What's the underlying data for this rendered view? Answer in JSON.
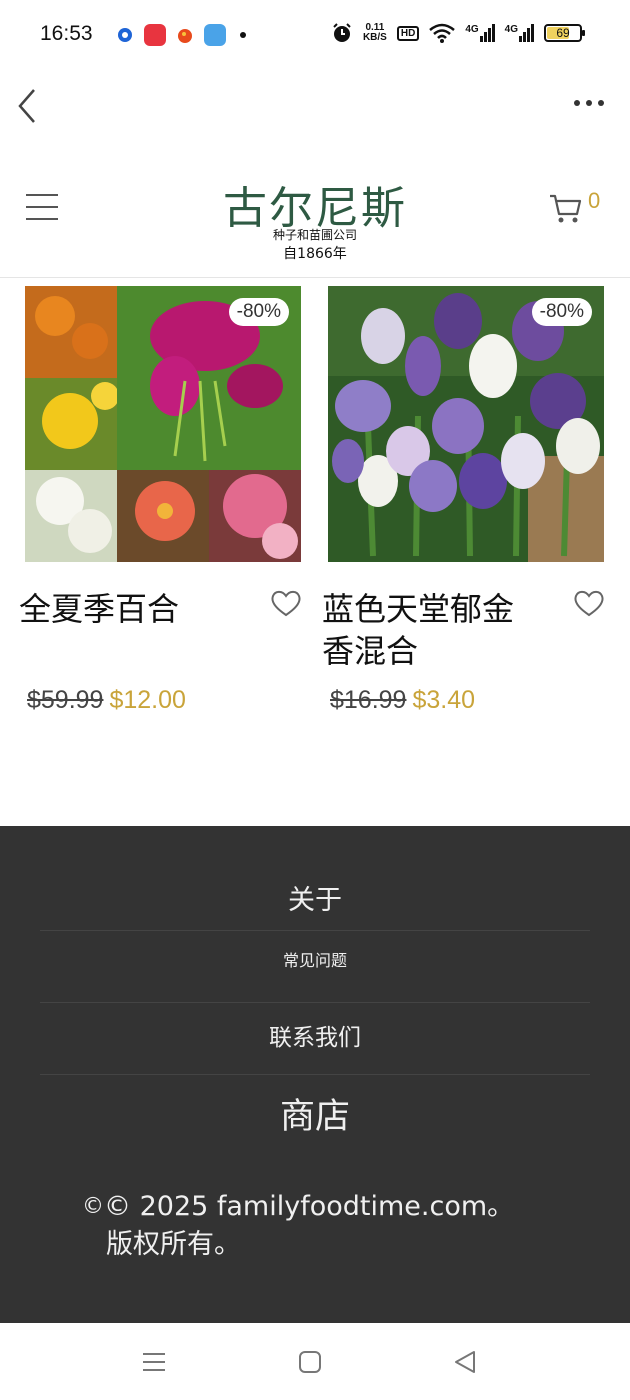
{
  "status_bar": {
    "time": "16:53",
    "network_speed": "0.11",
    "network_unit": "KB/S",
    "hd_label": "HD",
    "signal1_label": "4G",
    "signal2_label": "4G",
    "battery_level": "69",
    "battery_fraction": 0.69
  },
  "header": {
    "logo_title": "古尔尼斯",
    "logo_subtitle": "种子和苗圃公司",
    "logo_since": "自1866年",
    "cart_count": "0"
  },
  "products": [
    {
      "name": "全夏季百合",
      "discount_badge": "-80%",
      "old_price": "$59.99",
      "new_price": "$12.00"
    },
    {
      "name": "蓝色天堂郁金香混合",
      "discount_badge": "-80%",
      "old_price": "$16.99",
      "new_price": "$3.40"
    }
  ],
  "footer": {
    "about": "关于",
    "faq": "常见问题",
    "contact": "联系我们",
    "shop": "商店",
    "copyright_symbol": "©",
    "copyright_text": "© 2025 familyfoodtime.com。",
    "copyright_line2": "版权所有。"
  },
  "colors": {
    "brand_green": "#2e5a43",
    "accent_gold": "#c9a43a",
    "footer_bg": "#333333"
  }
}
